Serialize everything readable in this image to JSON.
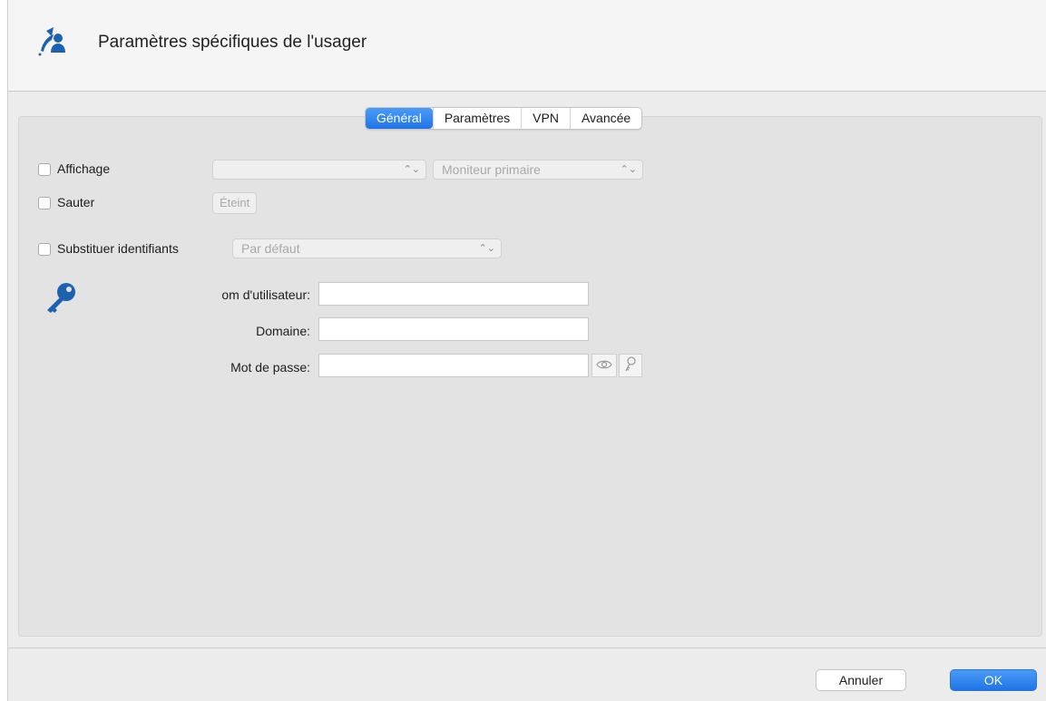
{
  "window": {
    "title": "Paramètres spécifiques de l'usager"
  },
  "tabs": [
    {
      "label": "Général",
      "active": true
    },
    {
      "label": "Paramètres",
      "active": false
    },
    {
      "label": "VPN",
      "active": false
    },
    {
      "label": "Avancée",
      "active": false
    }
  ],
  "general": {
    "affichage": {
      "label": "Affichage",
      "checked": false,
      "select1_value": "",
      "select2_value": "Moniteur primaire"
    },
    "sauter": {
      "label": "Sauter",
      "checked": false,
      "button_label": "Éteint"
    },
    "substituer": {
      "label": "Substituer identifiants",
      "checked": false,
      "select_value": "Par défaut"
    },
    "credentials": {
      "username_label": "om d'utilisateur:",
      "username_value": "",
      "domain_label": "Domaine:",
      "domain_value": "",
      "password_label": "Mot de passe:",
      "password_value": ""
    }
  },
  "footer": {
    "cancel_label": "Annuler",
    "ok_label": "OK"
  },
  "colors": {
    "accent": "#1f74e6",
    "key_icon": "#1d62b0"
  }
}
